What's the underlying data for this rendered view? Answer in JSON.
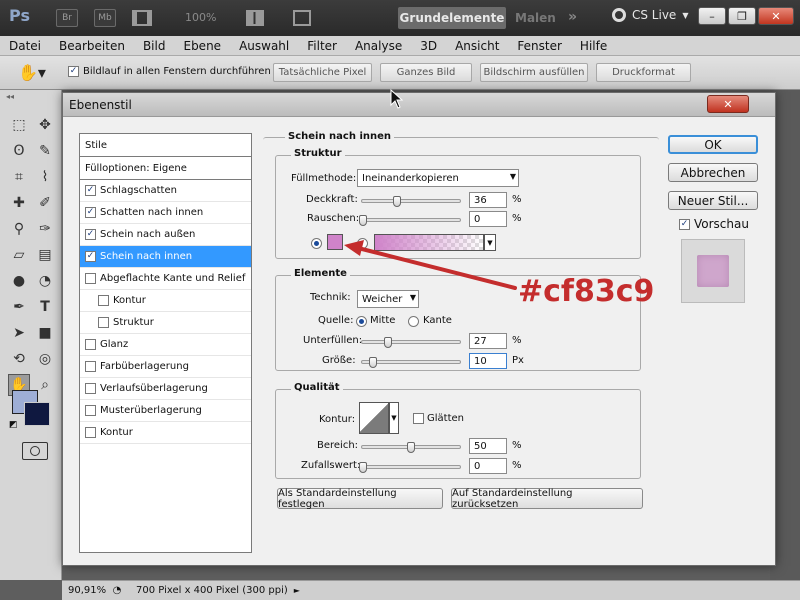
{
  "appbar": {
    "logo": "Ps",
    "br": "Br",
    "mb": "Mb",
    "zoom": "100%",
    "workspaces": [
      "Grundelemente",
      "Malen"
    ],
    "more": "»",
    "cslive": "CS Live",
    "icons": [
      "bridge-icon",
      "minibridge-icon",
      "filmstrip-icon",
      "arrange-icon",
      "screenmode-icon",
      "cslive-icon"
    ]
  },
  "menu": [
    "Datei",
    "Bearbeiten",
    "Bild",
    "Ebene",
    "Auswahl",
    "Filter",
    "Analyse",
    "3D",
    "Ansicht",
    "Fenster",
    "Hilfe"
  ],
  "options": {
    "scroll_all": "Bildlauf in allen Fenstern durchführen",
    "scroll_all_checked": true,
    "buttons": [
      "Tatsächliche Pixel",
      "Ganzes Bild",
      "Bildschirm ausfüllen",
      "Druckformat"
    ]
  },
  "dialog": {
    "title": "Ebenenstil",
    "close": "✕",
    "styles_header": "Stile",
    "blend_options": "Fülloptionen: Eigene",
    "styles": [
      {
        "label": "Schlagschatten",
        "checked": true,
        "sub": false
      },
      {
        "label": "Schatten nach innen",
        "checked": true,
        "sub": false
      },
      {
        "label": "Schein nach außen",
        "checked": true,
        "sub": false
      },
      {
        "label": "Schein nach innen",
        "checked": true,
        "sub": false,
        "selected": true
      },
      {
        "label": "Abgeflachte Kante und Relief",
        "checked": false,
        "sub": false
      },
      {
        "label": "Kontur",
        "checked": false,
        "sub": true
      },
      {
        "label": "Struktur",
        "checked": false,
        "sub": true
      },
      {
        "label": "Glanz",
        "checked": false,
        "sub": false
      },
      {
        "label": "Farbüberlagerung",
        "checked": false,
        "sub": false
      },
      {
        "label": "Verlaufsüberlagerung",
        "checked": false,
        "sub": false
      },
      {
        "label": "Musterüberlagerung",
        "checked": false,
        "sub": false
      },
      {
        "label": "Kontur",
        "checked": false,
        "sub": false
      }
    ],
    "section_title": "Schein nach innen",
    "structure": {
      "legend": "Struktur",
      "blend_mode_label": "Füllmethode:",
      "blend_mode": "Ineinanderkopieren",
      "opacity_label": "Deckkraft:",
      "opacity": "36",
      "opacity_unit": "%",
      "noise_label": "Rauschen:",
      "noise": "0",
      "noise_unit": "%",
      "glow_color": "#cf83c9"
    },
    "elements": {
      "legend": "Elemente",
      "technique_label": "Technik:",
      "technique": "Weicher",
      "source_label": "Quelle:",
      "source_center": "Mitte",
      "source_edge": "Kante",
      "choke_label": "Unterfüllen:",
      "choke": "27",
      "choke_unit": "%",
      "size_label": "Größe:",
      "size": "10",
      "size_unit": "Px"
    },
    "quality": {
      "legend": "Qualität",
      "contour_label": "Kontur:",
      "smooth_label": "Glätten",
      "range_label": "Bereich:",
      "range": "50",
      "range_unit": "%",
      "jitter_label": "Zufallswert:",
      "jitter": "0",
      "jitter_unit": "%"
    },
    "make_default": "Als Standardeinstellung festlegen",
    "reset_default": "Auf Standardeinstellung zurücksetzen",
    "ok": "OK",
    "cancel": "Abbrechen",
    "new_style": "Neuer Stil...",
    "preview_label": "Vorschau",
    "preview_checked": true
  },
  "annotation": {
    "text": "#cf83c9",
    "color": "#c42d2d"
  },
  "status": {
    "zoom": "90,91%",
    "info": "700 Pixel x 400 Pixel (300 ppi)"
  }
}
